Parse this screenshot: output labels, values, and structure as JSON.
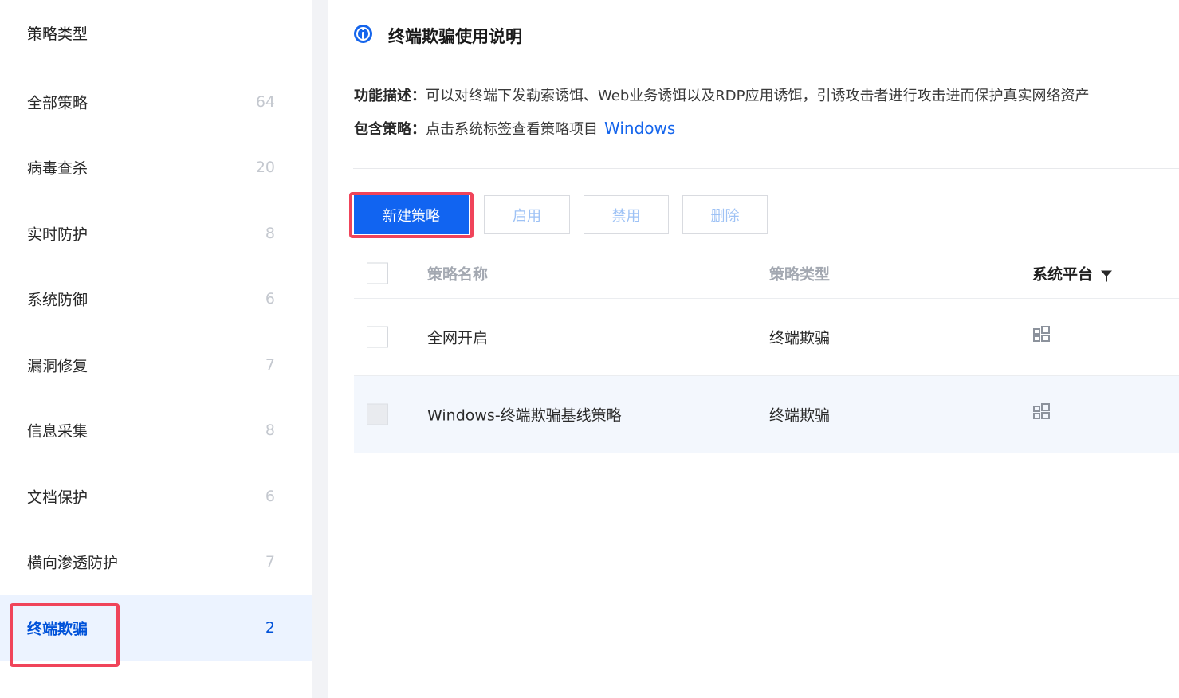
{
  "sidebar": {
    "title": "策略类型",
    "items": [
      {
        "label": "全部策略",
        "count": "64"
      },
      {
        "label": "病毒查杀",
        "count": "20"
      },
      {
        "label": "实时防护",
        "count": "8"
      },
      {
        "label": "系统防御",
        "count": "6"
      },
      {
        "label": "漏洞修复",
        "count": "7"
      },
      {
        "label": "信息采集",
        "count": "8"
      },
      {
        "label": "文档保护",
        "count": "6"
      },
      {
        "label": "横向渗透防护",
        "count": "7"
      },
      {
        "label": "终端欺骗",
        "count": "2",
        "active": true
      }
    ]
  },
  "help": {
    "title": "终端欺骗使用说明",
    "desc_key": "功能描述：",
    "desc_text": "可以对终端下发勒索诱饵、Web业务诱饵以及RDP应用诱饵，引诱攻击者进行攻击进而保护真实网络资产",
    "policy_key": "包含策略：",
    "policy_text": "点击系统标签查看策略项目",
    "policy_link": "Windows"
  },
  "toolbar": {
    "new_label": "新建策略",
    "enable_label": "启用",
    "disable_label": "禁用",
    "delete_label": "删除"
  },
  "table": {
    "columns": {
      "name": "策略名称",
      "type": "策略类型",
      "platform": "系统平台"
    },
    "rows": [
      {
        "name": "全网开启",
        "type": "终端欺骗",
        "platform_icon": "windows-icon"
      },
      {
        "name": "Windows-终端欺骗基线策略",
        "type": "终端欺骗",
        "platform_icon": "windows-icon"
      }
    ]
  },
  "colors": {
    "accent": "#1164f1",
    "highlight": "#f0445a",
    "active_bg": "#ecf3ff"
  }
}
